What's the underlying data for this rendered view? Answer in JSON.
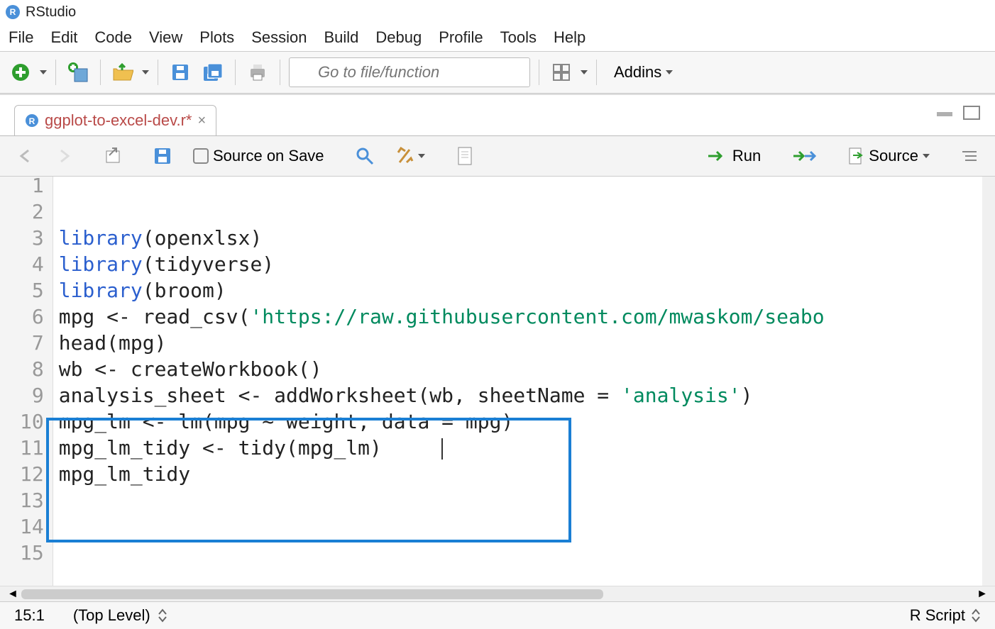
{
  "titlebar": {
    "app_name": "RStudio",
    "app_letter": "R"
  },
  "menubar": [
    "File",
    "Edit",
    "Code",
    "View",
    "Plots",
    "Session",
    "Build",
    "Debug",
    "Profile",
    "Tools",
    "Help"
  ],
  "toolbar": {
    "file_placeholder": "Go to file/function",
    "addins_label": "Addins"
  },
  "tab": {
    "title": "ggplot-to-excel-dev.r*",
    "close": "×"
  },
  "editor_toolbar": {
    "source_on_save": "Source on Save",
    "run": "Run",
    "source": "Source"
  },
  "code": {
    "lines": [
      {
        "n": 1,
        "html": "<span class='kw-blue'>library</span>(openxlsx)"
      },
      {
        "n": 2,
        "html": "<span class='kw-blue'>library</span>(tidyverse)"
      },
      {
        "n": 3,
        "html": "<span class='kw-blue'>library</span>(broom)"
      },
      {
        "n": 4,
        "html": ""
      },
      {
        "n": 5,
        "html": "mpg &lt;- read_csv(<span class='kw-str'>'https://raw.githubusercontent.com/mwaskom/seabo</span>"
      },
      {
        "n": 6,
        "html": "head(mpg)"
      },
      {
        "n": 7,
        "html": ""
      },
      {
        "n": 8,
        "html": "wb &lt;- createWorkbook()"
      },
      {
        "n": 9,
        "html": "analysis_sheet &lt;- addWorksheet(wb, sheetName = <span class='kw-str'>'analysis'</span>)"
      },
      {
        "n": 10,
        "html": ""
      },
      {
        "n": 11,
        "html": "mpg_lm &lt;- lm(mpg ~ weight, data = mpg)"
      },
      {
        "n": 12,
        "html": "mpg_lm_tidy &lt;- tidy(mpg_lm)"
      },
      {
        "n": 13,
        "html": ""
      },
      {
        "n": 14,
        "html": "mpg_lm_tidy"
      },
      {
        "n": 15,
        "html": ""
      }
    ]
  },
  "statusbar": {
    "position": "15:1",
    "scope": "(Top Level)",
    "lang": "R Script"
  }
}
